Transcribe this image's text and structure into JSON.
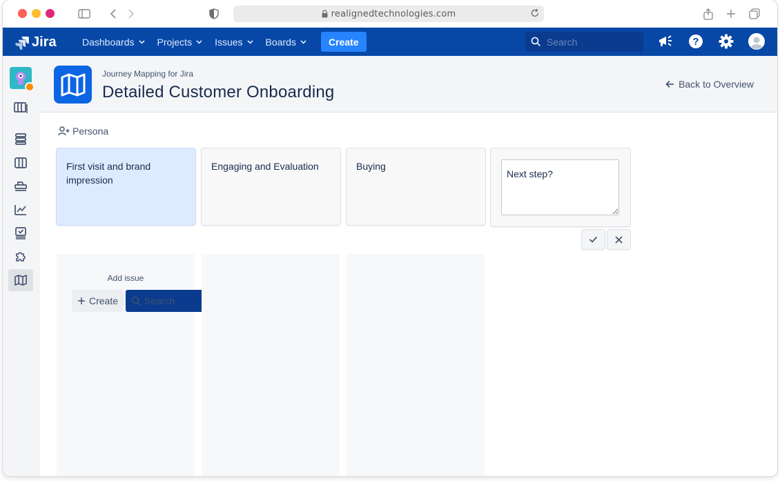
{
  "browser": {
    "url": "realignedtechnologies.com"
  },
  "nav": {
    "product": "Jira",
    "menu": [
      {
        "label": "Dashboards"
      },
      {
        "label": "Projects"
      },
      {
        "label": "Issues"
      },
      {
        "label": "Boards"
      }
    ],
    "create_label": "Create",
    "search_placeholder": "Search"
  },
  "header": {
    "app_name": "Journey Mapping for Jira",
    "title": "Detailed Customer Onboarding",
    "back_label": "Back to Overview"
  },
  "journey": {
    "persona_label": "Persona",
    "steps": [
      {
        "label": "First visit and brand impression"
      },
      {
        "label": "Engaging and Evaluation"
      },
      {
        "label": "Buying"
      }
    ],
    "new_step_value": "Next step?",
    "lane": {
      "add_issue_label": "Add issue",
      "create_label": "Create",
      "search_label": "Search"
    }
  },
  "icons": {
    "sidebar": [
      "project-avatar",
      "board-icon",
      "backlog-icon",
      "columns-icon",
      "releases-icon",
      "reports-icon",
      "issues-icon",
      "add-ons-icon",
      "journey-map-icon"
    ],
    "nav_right": [
      "notifications-icon",
      "help-icon",
      "settings-icon",
      "profile-avatar"
    ]
  },
  "colors": {
    "nav_bg": "#0747a6",
    "create_button": "#2684ff",
    "selected_step": "#deebff",
    "app_icon": "#0c66e4"
  }
}
